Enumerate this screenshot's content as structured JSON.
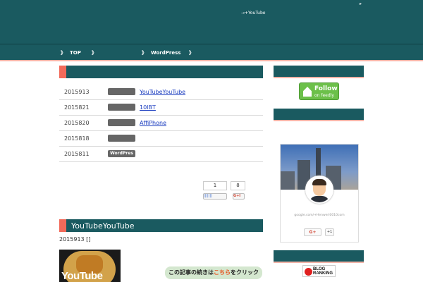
{
  "header": {
    "tagline": "→+YouTube",
    "corner_icon": "triangle-right"
  },
  "nav": {
    "items": [
      {
        "chevron": "》",
        "label": "TOP"
      },
      {
        "chevron": "》",
        "label": ""
      },
      {
        "chevron": "》",
        "label": "WordPress"
      },
      {
        "chevron": "》",
        "label": ""
      }
    ]
  },
  "news": {
    "rows": [
      {
        "date": "2015913",
        "badge": "",
        "link": "YouTubeYouTube"
      },
      {
        "date": "2015821",
        "badge": "",
        "link": "10IBT"
      },
      {
        "date": "2015820",
        "badge": "",
        "link": "AffiPhone"
      },
      {
        "date": "2015818",
        "badge": "",
        "link": ""
      },
      {
        "date": "2015811",
        "badge": "WordPres",
        "link": ""
      }
    ]
  },
  "share": {
    "count_left": "1",
    "count_right": "8",
    "btn_left": "|||||||",
    "btn_right": "G+I"
  },
  "post": {
    "title": "YouTubeYouTube",
    "meta": "2015913 []",
    "thumb_text": "YouTube",
    "continue_pre": "この記事の続きは",
    "continue_hl": "こちら",
    "continue_post": "をクリック"
  },
  "sidebar": {
    "feedly_follow": "Follow",
    "feedly_sub": "on feedly",
    "profile_url": "google.com/+Henwerl0010com",
    "gplus_label": "G+",
    "plus1_label": "+1",
    "blogrank_line1": "BLOG",
    "blogrank_line2": "RANKING"
  },
  "colors": {
    "header_bg": "#1a5a60",
    "accent_coral": "#f26a5a",
    "link_blue": "#1a3cbf"
  }
}
